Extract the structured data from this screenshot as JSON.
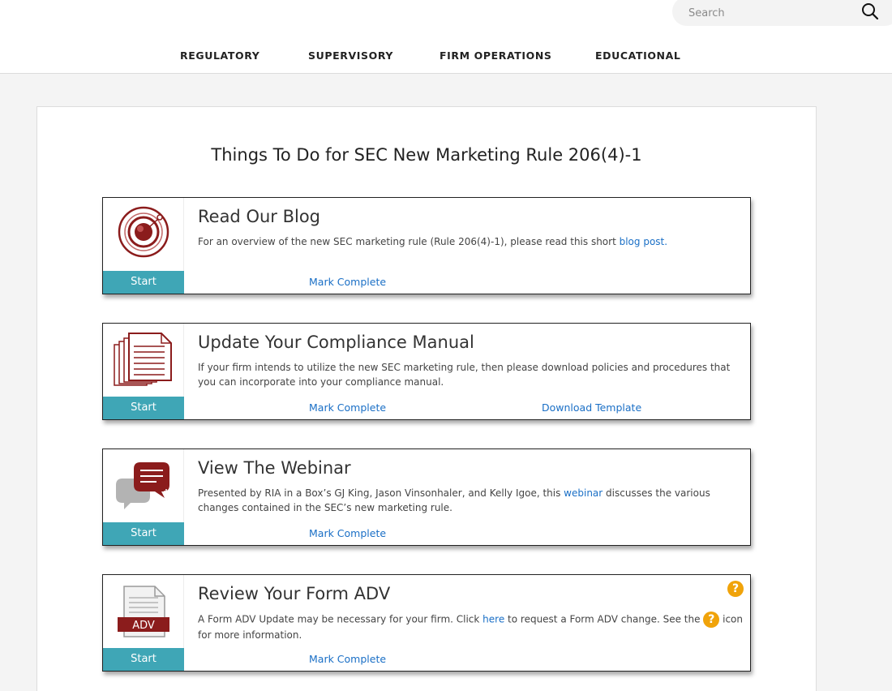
{
  "search": {
    "placeholder": "Search"
  },
  "nav": [
    {
      "label": "REGULATORY"
    },
    {
      "label": "SUPERVISORY"
    },
    {
      "label": "FIRM OPERATIONS"
    },
    {
      "label": "EDUCATIONAL"
    }
  ],
  "page": {
    "title": "Things To Do for SEC New Marketing Rule 206(4)-1"
  },
  "colors": {
    "accent": "#3fa6b6",
    "link": "#1a6fc6",
    "icon_red": "#8b1c1c",
    "help": "#f0a30a"
  },
  "cards": [
    {
      "title": "Read Our Blog",
      "desc_pre": "For an overview of the new SEC marketing rule (Rule 206(4)-1), please read this short ",
      "desc_link": "blog post.",
      "start": "Start",
      "mark_complete": "Mark Complete",
      "icon": "target-icon"
    },
    {
      "title": "Update Your Compliance Manual",
      "desc": "If your firm intends to utilize the new SEC marketing rule, then please download policies and procedures that you can incorporate into your compliance manual.",
      "start": "Start",
      "mark_complete": "Mark Complete",
      "download_template": "Download Template",
      "icon": "documents-icon"
    },
    {
      "title": "View The Webinar",
      "desc_pre": "Presented by RIA in a Box’s GJ King, Jason Vinsonhaler, and Kelly Igoe, this ",
      "desc_link": "webinar",
      "desc_post": " discusses the various changes contained in the SEC’s new marketing rule.",
      "start": "Start",
      "mark_complete": "Mark Complete",
      "icon": "chat-bubbles-icon"
    },
    {
      "title": "Review Your Form ADV",
      "desc_pre": "A Form ADV Update may be necessary for your firm. Click ",
      "desc_link": "here",
      "desc_mid": " to request a Form ADV change. See the ",
      "desc_post": " icon for more information.",
      "start": "Start",
      "mark_complete": "Mark Complete",
      "icon": "form-adv-icon",
      "icon_label": "ADV",
      "help_glyph": "?"
    }
  ]
}
